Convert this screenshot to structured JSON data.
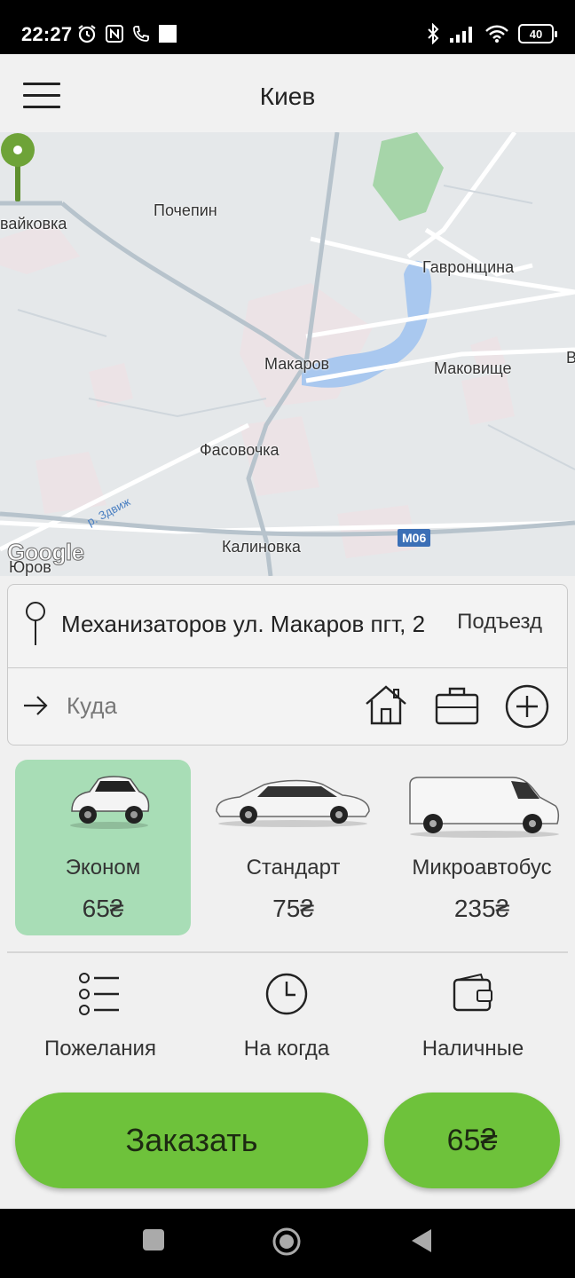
{
  "status_bar": {
    "time": "22:27",
    "battery": "40",
    "left_icons": [
      "alarm-icon",
      "nfc-icon",
      "call-icon",
      "square-notification-icon"
    ],
    "right_icons": [
      "bluetooth-icon",
      "signal-icon",
      "wifi-icon",
      "battery-icon"
    ]
  },
  "header": {
    "city": "Киев",
    "menu_icon": "hamburger-menu-icon"
  },
  "map": {
    "labels": {
      "vaykovka": "вайковка",
      "pochepin": "Почепин",
      "gavronshchina": "Гавронщина",
      "makarov": "Макаров",
      "makovishche": "Маковище",
      "edge_b": "В",
      "fasovochka": "Фасовочка",
      "kalinovka": "Калиновка",
      "yurov": "Юров",
      "river": "р. Здвиж",
      "road": "М06"
    },
    "logo": "Google",
    "pin_icon": "location-pin-icon",
    "colors": {
      "pin": "#6ea338",
      "water": "#a9c8ef",
      "park": "#a6d5a9"
    }
  },
  "address": {
    "from": "Механизаторов ул. Макаров пгт, 2",
    "entrance": "Подъезд",
    "to_placeholder": "Куда",
    "to_value": ""
  },
  "tariffs": [
    {
      "name": "Эконом",
      "price": "65₴",
      "selected": true
    },
    {
      "name": "Стандарт",
      "price": "75₴",
      "selected": false
    },
    {
      "name": "Микроавтобус",
      "price": "235₴",
      "selected": false
    }
  ],
  "options": [
    {
      "label": "Пожелания",
      "icon": "list-icon"
    },
    {
      "label": "На когда",
      "icon": "clock-icon"
    },
    {
      "label": "Наличные",
      "icon": "wallet-icon"
    }
  ],
  "actions": {
    "order": "Заказать",
    "price": "65₴"
  },
  "colors": {
    "accent": "#6ec23b",
    "selected_tariff": "#a8ddb6"
  }
}
